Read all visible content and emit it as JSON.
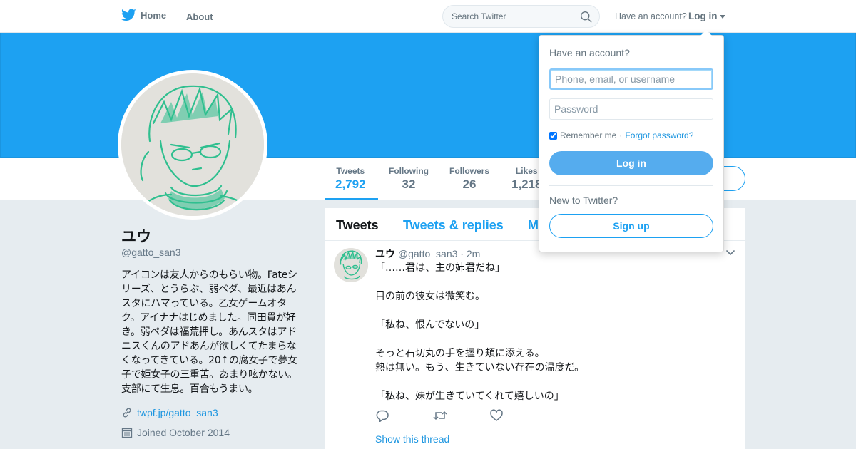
{
  "nav": {
    "home_label": "Home",
    "about_label": "About",
    "search_placeholder": "Search Twitter",
    "have_account": "Have an account?",
    "login_label": "Log in"
  },
  "colors": {
    "brand": "#1da1f2",
    "link": "#1b95e0",
    "login_button": "#55acee"
  },
  "profile": {
    "name": "ユウ",
    "handle": "@gatto_san3",
    "bio": "アイコンは友人からのもらい物。Fateシリーズ、とうらぶ、弱ペダ、最近はあんスタにハマっている。乙女ゲームオタク。アイナナはじめました。同田貫が好き。弱ペダは福荒押し。あんスタはアドニスくんのアドあんが欲しくてたまらなくなってきている。20↑の腐女子で夢女子で姫女子の三重苦。あまり呟かない。支部にて生息。百合もうまい。",
    "link": "twpf.jp/gatto_san3",
    "joined": "Joined October 2014",
    "link_icon": "link-icon",
    "calendar_icon": "calendar-icon"
  },
  "stats": [
    {
      "label": "Tweets",
      "value": "2,792"
    },
    {
      "label": "Following",
      "value": "32"
    },
    {
      "label": "Followers",
      "value": "26"
    },
    {
      "label": "Likes",
      "value": "1,218"
    }
  ],
  "timeline": {
    "tabs": [
      {
        "label": "Tweets"
      },
      {
        "label": "Tweets & replies"
      },
      {
        "label": "M"
      }
    ]
  },
  "tweet": {
    "name": "ユウ",
    "handle": "@gatto_san3",
    "separator": "·",
    "time": "2m",
    "lines": [
      "「……君は、主の姉君だね」",
      "",
      "目の前の彼女は微笑む。",
      "",
      "「私ね、恨んでないの」",
      "",
      "そっと石切丸の手を握り頬に添える。",
      "熱は無い。もう、生きていない存在の温度だ。",
      "",
      "「私ね、妹が生きていてくれて嬉しいの」"
    ],
    "show_thread": "Show this thread"
  },
  "login_dropdown": {
    "title": "Have an account?",
    "username_placeholder": "Phone, email, or username",
    "password_placeholder": "Password",
    "remember_me": "Remember me",
    "dot": "·",
    "forgot_password": "Forgot password?",
    "login_button": "Log in",
    "new_to_twitter": "New to Twitter?",
    "signup_button": "Sign up"
  }
}
